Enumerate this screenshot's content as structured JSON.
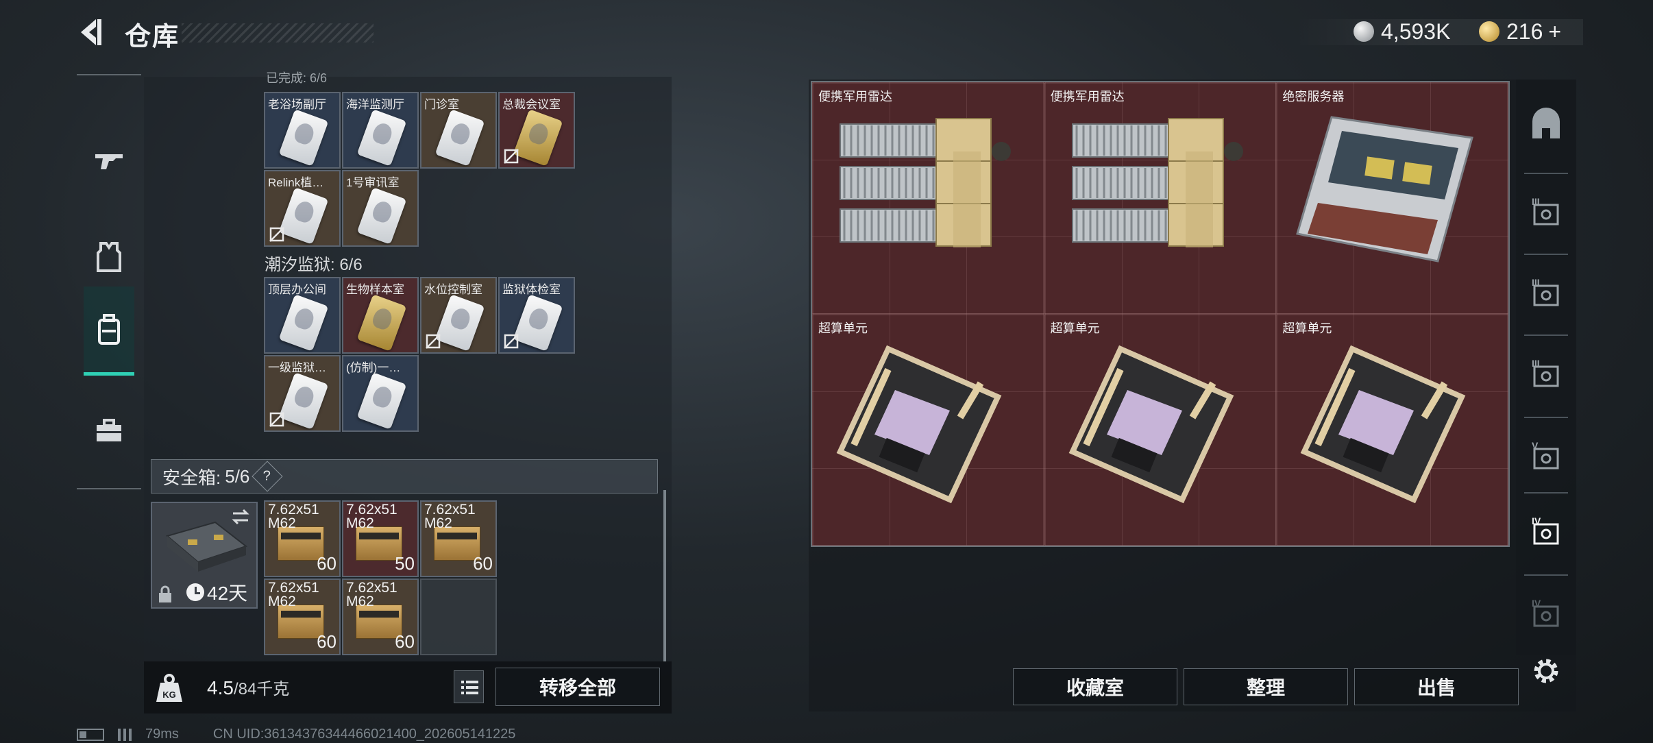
{
  "header": {
    "title": "仓库",
    "currency_1": "4,593K",
    "currency_2": "216",
    "plus": "+"
  },
  "left_panel": {
    "section_partial_label": "已完成: 6/6",
    "grid_a": [
      {
        "label": "老浴场副厅",
        "tone": "blue",
        "gold": false,
        "locked": false
      },
      {
        "label": "海洋监测厅",
        "tone": "blue",
        "gold": false,
        "locked": false
      },
      {
        "label": "门诊室",
        "tone": "brown",
        "gold": false,
        "locked": false
      },
      {
        "label": "总裁会议室",
        "tone": "red",
        "gold": true,
        "locked": true
      },
      {
        "label": "Relink植…",
        "tone": "brown",
        "gold": false,
        "locked": true
      },
      {
        "label": "1号审讯室",
        "tone": "brown",
        "gold": false,
        "locked": false
      }
    ],
    "section_title": "潮汐监狱: 6/6",
    "grid_b": [
      {
        "label": "顶层办公间",
        "tone": "blue",
        "gold": false,
        "locked": false
      },
      {
        "label": "生物样本室",
        "tone": "red",
        "gold": true,
        "locked": false
      },
      {
        "label": "水位控制室",
        "tone": "brown",
        "gold": false,
        "locked": true
      },
      {
        "label": "监狱体检室",
        "tone": "blue",
        "gold": false,
        "locked": true
      },
      {
        "label": "一级监狱…",
        "tone": "brown",
        "gold": false,
        "locked": true
      },
      {
        "label": "(仿制)一…",
        "tone": "blue",
        "gold": false,
        "locked": false
      }
    ]
  },
  "safe": {
    "title": "安全箱:",
    "count": "5/6",
    "help": "?",
    "timer": "42天",
    "ammo": [
      {
        "name": "7.62x51 M62",
        "count": "60",
        "tone": "brown"
      },
      {
        "name": "7.62x51 M62",
        "count": "50",
        "tone": "red"
      },
      {
        "name": "7.62x51 M62",
        "count": "60",
        "tone": "brown"
      },
      {
        "name": "7.62x51 M62",
        "count": "60",
        "tone": "brown"
      },
      {
        "name": "7.62x51 M62",
        "count": "60",
        "tone": "brown"
      }
    ]
  },
  "bottom_left": {
    "weight_badge": "KG",
    "weight_value": "4.5",
    "weight_total": "/84千克",
    "transfer_all": "转移全部"
  },
  "container": {
    "slots": [
      {
        "label": "便携军用雷达",
        "kind": "radar"
      },
      {
        "label": "便携军用雷达",
        "kind": "radar"
      },
      {
        "label": "绝密服务器",
        "kind": "server"
      },
      {
        "label": "超算单元",
        "kind": "board"
      },
      {
        "label": "超算单元",
        "kind": "board"
      },
      {
        "label": "超算单元",
        "kind": "board"
      }
    ]
  },
  "right_tabs": [
    "home-icon",
    "level-III-a-icon",
    "level-III-b-icon",
    "level-III-c-icon",
    "level-V-icon",
    "level-IV-active-icon",
    "level-IV-dim-icon"
  ],
  "tab_levels": [
    "",
    "III",
    "III",
    "III",
    "V",
    "IV",
    "IV"
  ],
  "actions": {
    "collection": "收藏室",
    "sort": "整理",
    "sell": "出售"
  },
  "status": {
    "ping": "79ms",
    "uid": "CN UID:361343763444660214​00_202605141225"
  },
  "colors": {
    "accent": "#2fd1b5",
    "container_bg": "#4d2629"
  }
}
